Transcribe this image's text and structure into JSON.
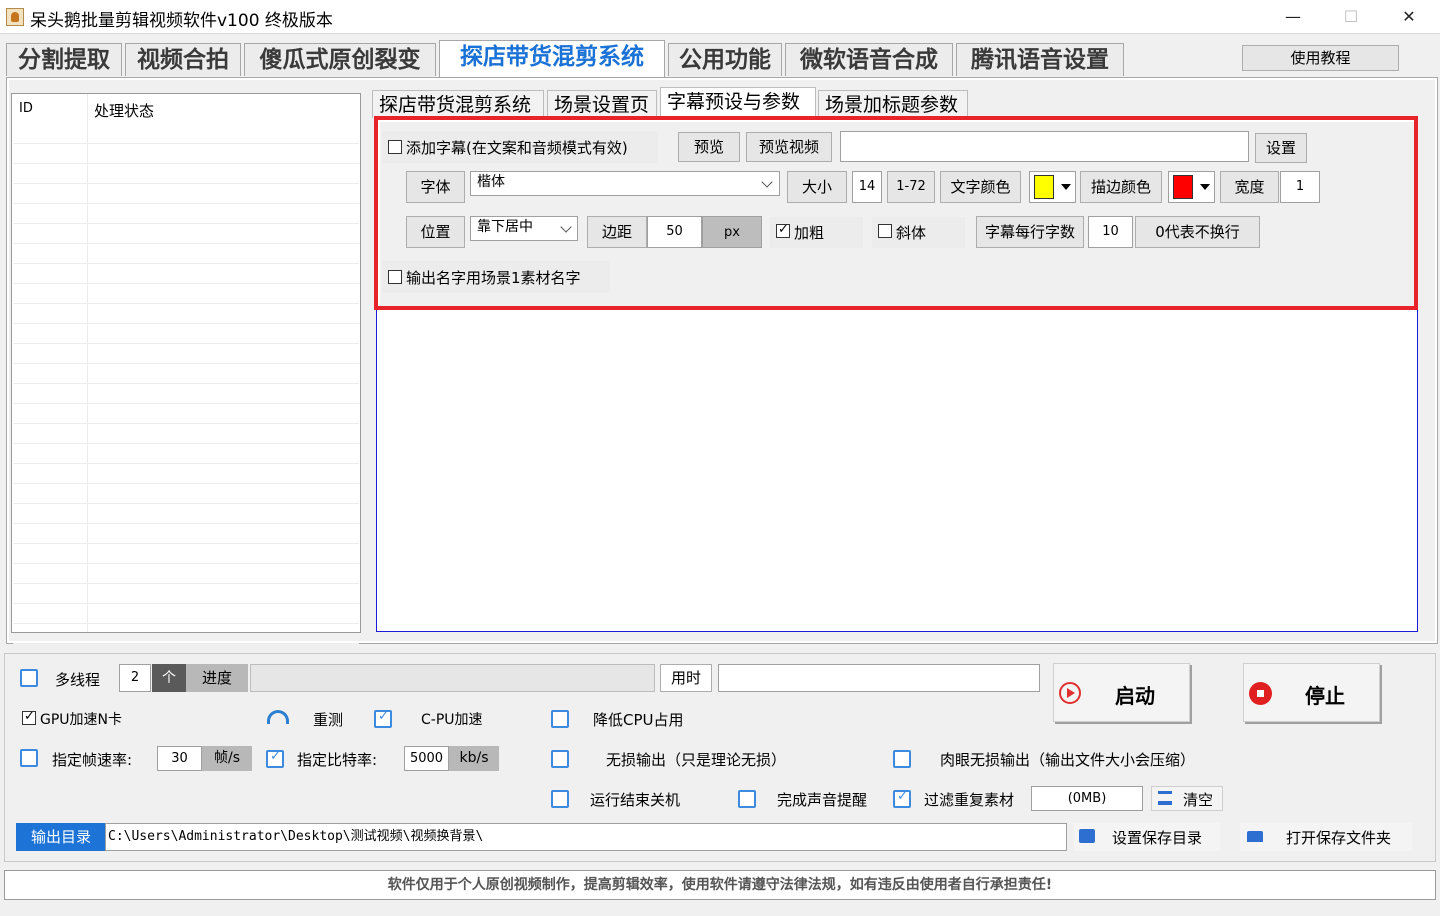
{
  "window": {
    "title": "呆头鹅批量剪辑视频软件v100 终极版本",
    "minimize": "—",
    "maximize": "☐",
    "close": "✕"
  },
  "main_tabs": [
    "分割提取",
    "视频合拍",
    "傻瓜式原创裂变",
    "探店带货混剪系统",
    "公用功能",
    "微软语音合成",
    "腾讯语音设置"
  ],
  "tutorial_button": "使用教程",
  "task_list": {
    "col_id": "ID",
    "col_status": "处理状态"
  },
  "sub_tabs": [
    "探店带货混剪系统",
    "场景设置页",
    "字幕预设与参数",
    "场景加标题参数"
  ],
  "subtitle": {
    "add_subtitle_label": "添加字幕(在文案和音频模式有效)",
    "preview": "预览",
    "preview_video": "预览视频",
    "settings": "设置",
    "font_btn": "字体",
    "font_value": "楷体",
    "size_btn": "大小",
    "size_value": "14",
    "size_range": "1-72",
    "text_color_btn": "文字颜色",
    "stroke_color_btn": "描边颜色",
    "width_btn": "宽度",
    "width_value": "1",
    "position_btn": "位置",
    "position_value": "靠下居中",
    "margin_btn": "边距",
    "margin_value": "50",
    "margin_unit": "px",
    "bold_label": "加粗",
    "italic_label": "斜体",
    "chars_per_line_btn": "字幕每行字数",
    "chars_per_line_value": "10",
    "chars_hint": "0代表不换行",
    "output_name_label": "输出名字用场景1素材名字",
    "colors": {
      "text": "#ffff00",
      "stroke": "#ff0000"
    }
  },
  "bottom": {
    "multithread_label": "多线程",
    "thread_count": "2",
    "thread_unit": "个",
    "progress_label": "进度",
    "elapsed_label": "用时",
    "start_button": "启动",
    "stop_button": "停止",
    "gpu_label": "GPU加速N卡",
    "retest_label": "重测",
    "cpu_accel_label": "C-PU加速",
    "lower_cpu_label": "降低CPU占用",
    "fps_label": "指定帧速率:",
    "fps_value": "30",
    "fps_unit": "帧/s",
    "bitrate_label": "指定比特率:",
    "bitrate_value": "5000",
    "bitrate_unit": "kb/s",
    "lossless_label": "无损输出（只是理论无损）",
    "visual_lossless_label": "肉眼无损输出（输出文件大小会压缩）",
    "shutdown_label": "运行结束关机",
    "sound_label": "完成声音提醒",
    "filter_label": "过滤重复素材",
    "filter_size": "(0MB)",
    "clear_label": "清空",
    "output_dir_label": "输出目录",
    "output_dir_value": "C:\\Users\\Administrator\\Desktop\\测试视频\\视频换背景\\",
    "set_dir_label": "设置保存目录",
    "open_dir_label": "打开保存文件夹"
  },
  "footer": "软件仅用于个人原创视频制作，提高剪辑效率，使用软件请遵守法律法规，如有违反由使用者自行承担责任!"
}
